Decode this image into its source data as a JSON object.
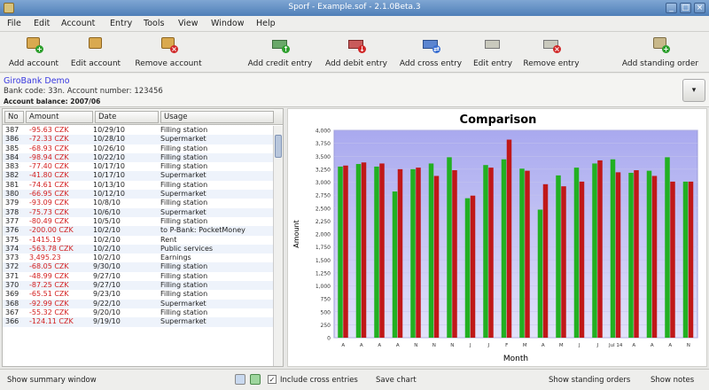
{
  "window": {
    "title": "Sporf - Example.sof - 2.1.0Beta.3"
  },
  "menu": [
    "File",
    "Edit",
    "Account",
    "Entry",
    "Tools",
    "View",
    "Window",
    "Help"
  ],
  "toolbar": {
    "add_account": "Add account",
    "edit_account": "Edit account",
    "remove_account": "Remove account",
    "add_credit": "Add credit entry",
    "add_debit": "Add debit entry",
    "add_cross": "Add cross entry",
    "edit_entry": "Edit entry",
    "remove_entry": "Remove entry",
    "add_standing": "Add standing order"
  },
  "account": {
    "name": "GiroBank Demo",
    "details": "Bank code: 33n. Account number: 123456",
    "balance": "Account balance: 2007/06"
  },
  "table": {
    "headers": [
      "No",
      "Amount",
      "Date",
      "Usage"
    ],
    "rows": [
      [
        "387",
        "-95.63 CZK",
        "10/29/10",
        "Filling station"
      ],
      [
        "386",
        "-72.33 CZK",
        "10/28/10",
        "Supermarket"
      ],
      [
        "385",
        "-68.93 CZK",
        "10/26/10",
        "Filling station"
      ],
      [
        "384",
        "-98.94 CZK",
        "10/22/10",
        "Filling station"
      ],
      [
        "383",
        "-77.40 CZK",
        "10/17/10",
        "Filling station"
      ],
      [
        "382",
        "-41.80 CZK",
        "10/17/10",
        "Supermarket"
      ],
      [
        "381",
        "-74.61 CZK",
        "10/13/10",
        "Filling station"
      ],
      [
        "380",
        "-66.95 CZK",
        "10/12/10",
        "Supermarket"
      ],
      [
        "379",
        "-93.09 CZK",
        "10/8/10",
        "Filling station"
      ],
      [
        "378",
        "-75.73 CZK",
        "10/6/10",
        "Supermarket"
      ],
      [
        "377",
        "-80.49 CZK",
        "10/5/10",
        "Filling station"
      ],
      [
        "376",
        "-200.00 CZK",
        "10/2/10",
        "to P-Bank: PocketMoney"
      ],
      [
        "375",
        "-1415.19",
        "10/2/10",
        "Rent"
      ],
      [
        "374",
        "-563.78 CZK",
        "10/2/10",
        "Public services"
      ],
      [
        "373",
        "3,495.23",
        "10/2/10",
        "Earnings"
      ],
      [
        "372",
        "-68.05 CZK",
        "9/30/10",
        "Filling station"
      ],
      [
        "371",
        "-48.99 CZK",
        "9/27/10",
        "Filling station"
      ],
      [
        "370",
        "-87.25 CZK",
        "9/27/10",
        "Filling station"
      ],
      [
        "369",
        "-65.51 CZK",
        "9/23/10",
        "Filling station"
      ],
      [
        "368",
        "-92.99 CZK",
        "9/22/10",
        "Supermarket"
      ],
      [
        "367",
        "-55.32 CZK",
        "9/20/10",
        "Filling station"
      ],
      [
        "366",
        "-124.11 CZK",
        "9/19/10",
        "Supermarket"
      ]
    ]
  },
  "chart_data": {
    "type": "bar",
    "title": "Comparison",
    "xlabel": "Month",
    "ylabel": "Amount",
    "ylim": [
      0,
      4000
    ],
    "yticks": [
      "0",
      "250",
      "500",
      "750",
      "1,000",
      "1,250",
      "1,500",
      "1,750",
      "2,000",
      "2,250",
      "2,500",
      "2,750",
      "3,000",
      "3,250",
      "3,500",
      "3,750",
      "4,000"
    ],
    "categories": [
      "A",
      "A",
      "A",
      "A",
      "N",
      "N",
      "N",
      "J",
      "J",
      "F",
      "M",
      "A",
      "M",
      "J",
      "J",
      "Jul 14",
      "A",
      "A",
      "A",
      "N"
    ],
    "series": [
      {
        "values": [
          3300,
          3350,
          3300,
          2820,
          3250,
          3360,
          3480,
          2690,
          3330,
          3440,
          3260,
          2470,
          3130,
          3280,
          3360,
          3440,
          3180,
          3220,
          3480,
          3010
        ]
      },
      {
        "values": [
          3320,
          3380,
          3360,
          3250,
          3280,
          3120,
          3230,
          2740,
          3280,
          3820,
          3220,
          2960,
          2920,
          3010,
          3420,
          3190,
          3230,
          3120,
          3010,
          3010
        ]
      }
    ],
    "colors": {
      "income": "#22b022",
      "expense": "#c01818",
      "plot_bg_top": "#a9a9ef",
      "plot_bg_bottom": "#e2e2fa"
    }
  },
  "status": {
    "summary": "Show summary window",
    "include_cross": "Include cross entries",
    "save_chart": "Save chart",
    "standing_orders": "Show standing orders",
    "notes": "Show notes"
  }
}
